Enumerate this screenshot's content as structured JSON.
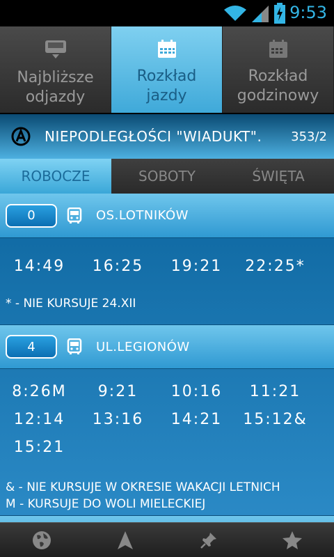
{
  "statusbar": {
    "time": "9:53"
  },
  "tabs": [
    {
      "label_line1": "Najbliższe",
      "label_line2": "odjazdy",
      "icon": "bus-list-icon"
    },
    {
      "label_line1": "Rozkład",
      "label_line2": "jazdy",
      "icon": "calendar-icon"
    },
    {
      "label_line1": "Rozkład",
      "label_line2": "godzinowy",
      "icon": "calendar-icon"
    }
  ],
  "stop": {
    "name": "NIEPODLEGŁOŚCI \"WIADUKT\".",
    "number": "353/2"
  },
  "day_tabs": [
    "ROBOCZE",
    "SOBOTY",
    "ŚWIĘTA"
  ],
  "lines": [
    {
      "number": "0",
      "destination": "OS.LOTNIKÓW",
      "times": [
        [
          "14:49",
          "16:25",
          "19:21",
          "22:25*"
        ]
      ],
      "notes": [
        "* - NIE KURSUJE 24.XII"
      ]
    },
    {
      "number": "4",
      "destination": "UL.LEGIONÓW",
      "times": [
        [
          "8:26M",
          "9:21",
          "10:16",
          "11:21"
        ],
        [
          "12:14",
          "13:16",
          "14:21",
          "15:12&"
        ],
        [
          "15:21"
        ]
      ],
      "notes": [
        "& - NIE KURSUJE W OKRESIE WAKACJI LETNICH",
        "M - KURSUJE DO WOLI MIELECKIEJ"
      ]
    }
  ],
  "colors": {
    "accent": "#33b5e5",
    "header_blue": "#3fa9d9"
  }
}
